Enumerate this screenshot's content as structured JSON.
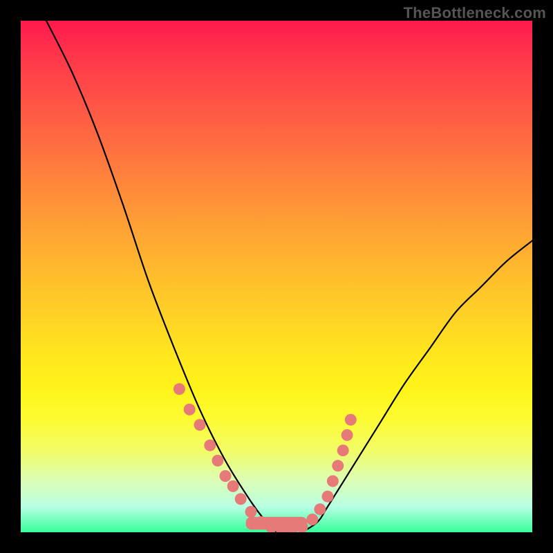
{
  "watermark": "TheBottleneck.com",
  "colors": {
    "frame_border": "#000000",
    "curve": "#000000",
    "dots": "#e67a78",
    "gradient_top": "#ff1a4d",
    "gradient_bottom": "#37ff9a"
  },
  "chart_data": {
    "type": "line",
    "title": "",
    "xlabel": "",
    "ylabel": "",
    "xlim": [
      0,
      100
    ],
    "ylim": [
      0,
      100
    ],
    "series": [
      {
        "name": "bottleneck-curve-left",
        "x": [
          5,
          10,
          15,
          20,
          25,
          30,
          35,
          40,
          45,
          48,
          50
        ],
        "y": [
          100,
          90,
          78,
          64,
          49,
          36,
          24,
          14,
          6,
          2,
          0
        ]
      },
      {
        "name": "bottleneck-curve-right",
        "x": [
          55,
          58,
          60,
          65,
          70,
          75,
          80,
          85,
          90,
          95,
          100
        ],
        "y": [
          0,
          2,
          5,
          13,
          21,
          29,
          36,
          43,
          48,
          53,
          57
        ]
      }
    ],
    "markers": {
      "name": "highlighted-points",
      "color": "#e67a78",
      "points": [
        {
          "x": 31,
          "y": 28
        },
        {
          "x": 33,
          "y": 24
        },
        {
          "x": 35,
          "y": 21
        },
        {
          "x": 37,
          "y": 17
        },
        {
          "x": 38.5,
          "y": 14
        },
        {
          "x": 40,
          "y": 11
        },
        {
          "x": 41.5,
          "y": 9
        },
        {
          "x": 43,
          "y": 6.5
        },
        {
          "x": 45,
          "y": 4
        },
        {
          "x": 47,
          "y": 2
        },
        {
          "x": 49,
          "y": 1
        },
        {
          "x": 51,
          "y": 0.5
        },
        {
          "x": 53,
          "y": 0.5
        },
        {
          "x": 55,
          "y": 1
        },
        {
          "x": 57,
          "y": 2.5
        },
        {
          "x": 58.5,
          "y": 4.5
        },
        {
          "x": 60,
          "y": 7
        },
        {
          "x": 61,
          "y": 10
        },
        {
          "x": 62,
          "y": 13
        },
        {
          "x": 63,
          "y": 16
        },
        {
          "x": 63.8,
          "y": 19
        },
        {
          "x": 64.5,
          "y": 22
        }
      ]
    },
    "baseline_strip": {
      "x_start": 44,
      "x_end": 56,
      "y": 0.5,
      "height": 2.5
    }
  }
}
